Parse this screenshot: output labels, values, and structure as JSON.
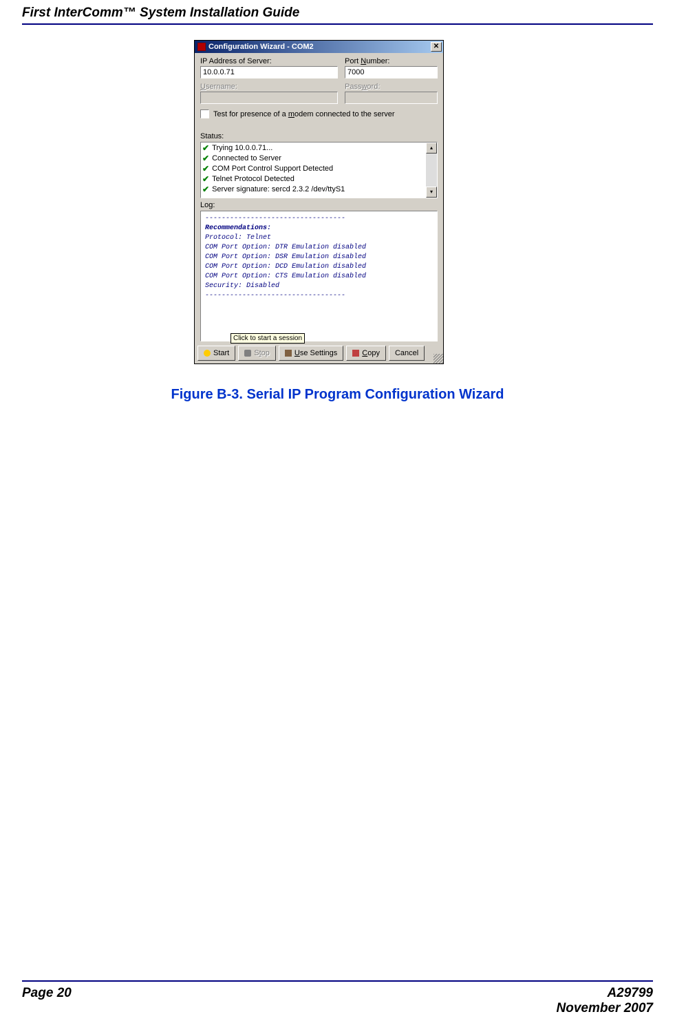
{
  "doc": {
    "header_title": "First InterComm™ System Installation Guide",
    "figure_caption": "Figure B-3.  Serial IP Program Configuration Wizard",
    "footer_left": "Page 20",
    "footer_right_code": "A29799",
    "footer_right_date": "November 2007"
  },
  "dialog": {
    "title": "Configuration Wizard - COM2",
    "ip_label": "IP Address of Server:",
    "ip_value": "10.0.0.71",
    "port_label": "Port Number:",
    "port_value": "7000",
    "user_label": "Username:",
    "user_value": "",
    "pass_label": "Password:",
    "pass_value": "",
    "modem_checkbox": "Test for presence of a modem connected to the server",
    "status_label": "Status:",
    "status_lines": [
      "Trying 10.0.0.71...",
      "Connected to Server",
      "COM Port Control Support Detected",
      "Telnet Protocol Detected",
      "Server signature: sercd 2.3.2 /dev/ttyS1"
    ],
    "log_label": "Log:",
    "log_lines": [
      "----------------------------------",
      "Recommendations:",
      "",
      "Protocol: Telnet",
      "COM Port Option: DTR Emulation disabled",
      "COM Port Option: DSR Emulation disabled",
      "COM Port Option: DCD Emulation disabled",
      "COM Port Option: CTS Emulation disabled",
      "Security: Disabled",
      "----------------------------------"
    ],
    "tooltip": "Click to start a session",
    "buttons": {
      "start": "Start",
      "stop": "Stop",
      "use_settings": "Use Settings",
      "copy": "Copy",
      "cancel": "Cancel"
    }
  }
}
